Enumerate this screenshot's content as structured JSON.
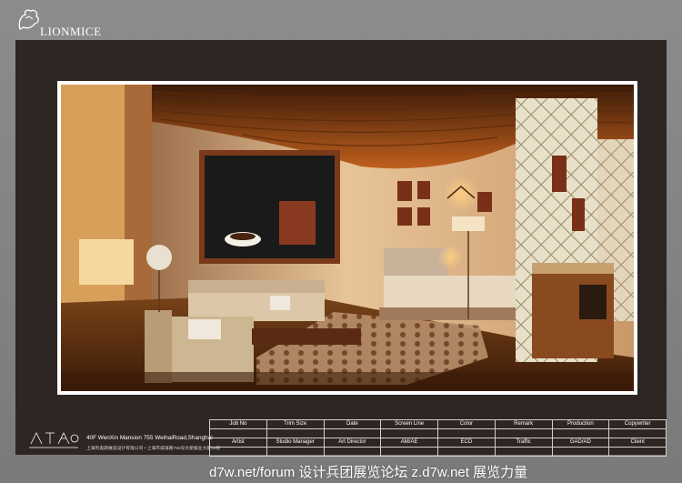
{
  "logo": {
    "text": "LIONMICE",
    "icon": "lion-logo-icon"
  },
  "footer": {
    "address": "40F WenXin Mansion 755 WeihaiRoad,Shanghai",
    "address_cn": "上海利奥斯展览设计有限公司 • 上海市威海路755号文新报业大厦40楼",
    "brand_icon": "exhibition-brand-icon"
  },
  "info_table": {
    "row1": [
      "Job No",
      "Trim Size",
      "Date",
      "Screen Line",
      "Color",
      "Remark",
      "Production",
      "Copywriter"
    ],
    "row2": [
      "Artist",
      "Studio Manager",
      "Art Director",
      "AM/AE",
      "ECD",
      "Traffic",
      "GAD/AD",
      "Client"
    ]
  },
  "watermark": "d7w.net/forum 设计兵团展览论坛  z.d7w.net 展览力量",
  "render": {
    "description_icon": "hotel-room-render-image"
  }
}
